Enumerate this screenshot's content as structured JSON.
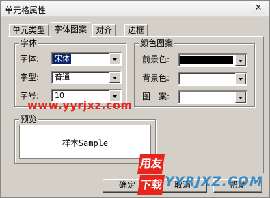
{
  "window": {
    "title": "单元格属性",
    "close_glyph": "✕"
  },
  "tabs": [
    {
      "label": "单元类型"
    },
    {
      "label": "字体图案",
      "active": true
    },
    {
      "label": "对齐"
    },
    {
      "label": "边框"
    }
  ],
  "font_group": {
    "title": "字体",
    "font_label": "字体:",
    "font_value": "宋体",
    "style_label": "字型:",
    "style_value": "普通",
    "size_label": "字号:",
    "size_value": "10"
  },
  "pattern_group": {
    "title": "颜色图案",
    "fg_label": "前景色:",
    "fg_color": "#000000",
    "bg_label": "背景色:",
    "bg_color": "#ffffff",
    "pattern_label": "图　案:",
    "pattern_color": "#ffffff"
  },
  "preview": {
    "title": "预览",
    "sample_text": "样本Sample"
  },
  "buttons": {
    "ok": "确定",
    "cancel": "取消",
    "help": "帮助"
  },
  "watermarks": {
    "url": "www.yyrjxz.com",
    "logo_top": "用友",
    "logo_bottom": "下载",
    "site": "YYRJXZ.COM"
  }
}
